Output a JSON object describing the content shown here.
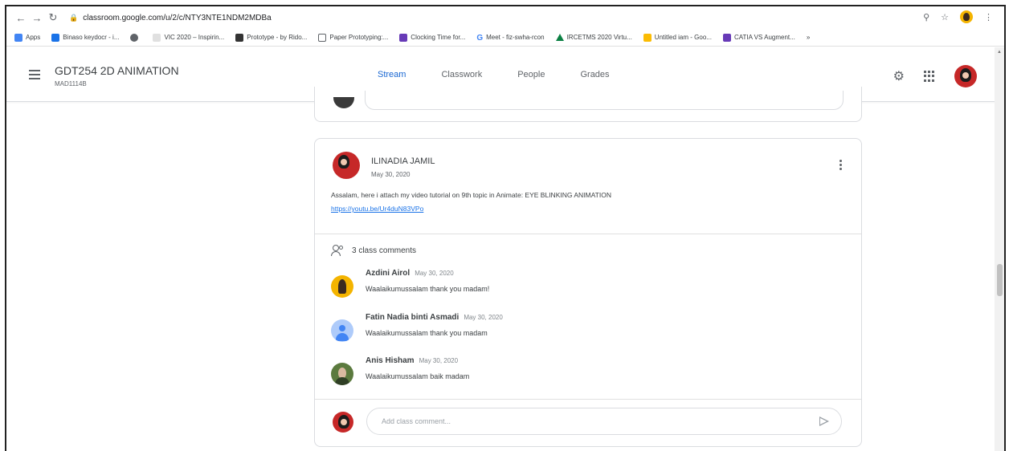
{
  "browser": {
    "url": "classroom.google.com/u/2/c/NTY3NTE1NDM2MDBa",
    "bookmarks": [
      {
        "label": "Apps",
        "color": "#4285f4"
      },
      {
        "label": "Binaso keydocr - i...",
        "color": "#1a73e8"
      },
      {
        "label": "",
        "color": "#5f6368"
      },
      {
        "label": "VIC 2020 – Inspirin...",
        "color": "#9aa0a6"
      },
      {
        "label": "Prototype - by Rido...",
        "color": "#333333"
      },
      {
        "label": "Paper Prototyping:...",
        "color": "#ffffff"
      },
      {
        "label": "Clocking Time for...",
        "color": "#673ab7"
      },
      {
        "label": "Meet - fiz-swha-rcon",
        "color": "#34a853"
      },
      {
        "label": "IRCETMS 2020 Virtu...",
        "color": "#0b8043"
      },
      {
        "label": "Untitled iam - Goo...",
        "color": "#fbbc04"
      },
      {
        "label": "CATIA VS Augment...",
        "color": "#673ab7"
      }
    ]
  },
  "course": {
    "title": "GDT254 2D ANIMATION",
    "section": "MAD1114B"
  },
  "tabs": [
    {
      "label": "Stream",
      "active": true
    },
    {
      "label": "Classwork",
      "active": false
    },
    {
      "label": "People",
      "active": false
    },
    {
      "label": "Grades",
      "active": false
    }
  ],
  "post": {
    "author": "ILINADIA JAMIL",
    "date": "May 30, 2020",
    "text": "Assalam, here i attach my video tutorial on 9th topic in Animate: EYE BLINKING ANIMATION",
    "link": "https://youtu.be/Ur4duN83VPo",
    "comments_label": "3 class comments",
    "comments": [
      {
        "name": "Azdini Airol",
        "date": "May 30, 2020",
        "text": "Waalaikumussalam thank you madam!"
      },
      {
        "name": "Fatin Nadia binti Asmadi",
        "date": "May 30, 2020",
        "text": "Waalaikumussalam thank you madam"
      },
      {
        "name": "Anis Hisham",
        "date": "May 30, 2020",
        "text": "Waalaikumussalam baik madam"
      }
    ],
    "add_comment_placeholder": "Add class comment..."
  }
}
